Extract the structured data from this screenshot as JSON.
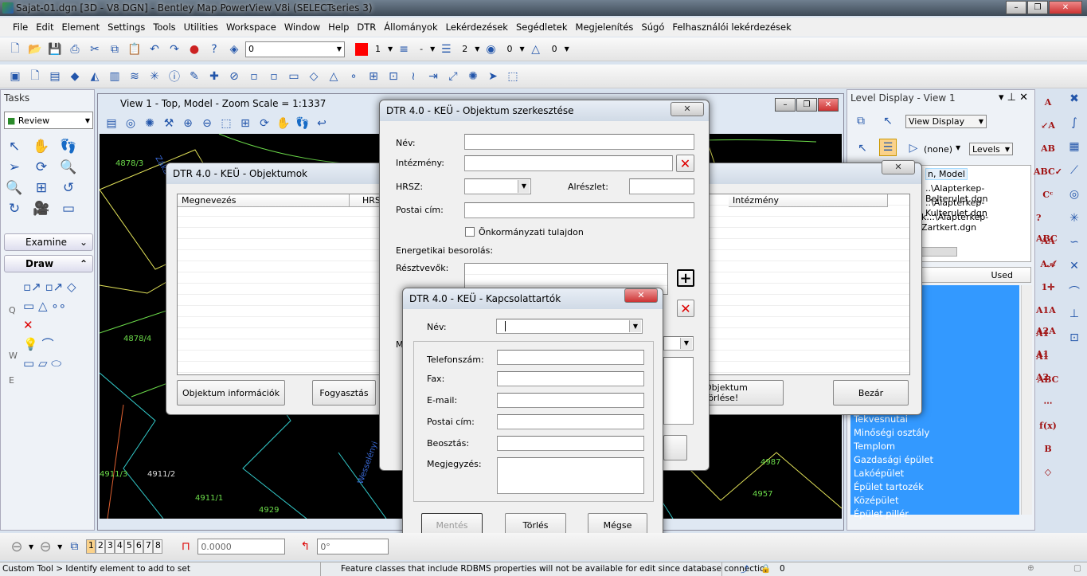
{
  "window": {
    "title": "Sajat-01.dgn [3D - V8 DGN] - Bentley Map PowerView V8i (SELECTseries 3)",
    "minimize": "–",
    "maximize": "❐",
    "close": "✕"
  },
  "menu": [
    "File",
    "Edit",
    "Element",
    "Settings",
    "Tools",
    "Utilities",
    "Workspace",
    "Window",
    "Help",
    "DTR",
    "Állományok",
    "Lekérdezések",
    "Segédletek",
    "Megjelenítés",
    "Súgó",
    "Felhasználói lekérdezések"
  ],
  "toolbar1": {
    "icons": [
      "new-file-icon",
      "open-folder-icon",
      "save-icon",
      "print-icon",
      "cut-icon",
      "copy-icon",
      "paste-icon",
      "undo-icon",
      "redo-icon",
      "render-icon",
      "help-icon",
      "level-icon"
    ],
    "level_value": "0",
    "color_value": "1",
    "style_value": "-",
    "weight_value": "2",
    "transparency_value": "0",
    "priority_value": "0",
    "color_accent": "#ff0000"
  },
  "toolbar2": {
    "icons": [
      "view-cube-icon",
      "model-icon",
      "references-icon",
      "raster-icon",
      "terrain-icon",
      "level-manager-icon",
      "layers-icon",
      "magic-icon",
      "info-icon",
      "edit-icon",
      "snap-icon",
      "no-entry-icon",
      "place-fence-icon",
      "modify-fence-icon",
      "fence-stretch-icon",
      "arc-icon",
      "triangle-icon",
      "circles-icon",
      "group-icon",
      "copy-element-icon",
      "wave-icon",
      "mirror-icon",
      "measure-icon",
      "bulb-icon",
      "select-arrow-icon",
      "select-box-icon"
    ]
  },
  "tasks": {
    "title": "Tasks",
    "review_label": "Review",
    "examine_label": "Examine",
    "draw_label": "Draw",
    "row_letters": [
      "Q",
      "W",
      "E"
    ]
  },
  "view": {
    "title": "View 1 - Top, Model - Zoom Scale = 1:1337"
  },
  "map_labels": [
    "4878/3",
    "Zákány",
    "4878/4",
    "4911/3",
    "4911/2",
    "4911/1",
    "4929",
    "4987",
    "4957",
    "Wesselényi"
  ],
  "objektumok": {
    "title": "DTR 4.0 - KEÜ - Objektumok",
    "columns": [
      "Megnevezés",
      "HRSZ",
      "Intézmény"
    ],
    "buttons": {
      "info": "Objektum információk",
      "fogyasztas": "Fogyasztás",
      "torles": "Objektum törlése!",
      "bezar": "Bezár"
    }
  },
  "szerkesztes": {
    "title": "DTR 4.0 - KEÜ - Objektum szerkesztése",
    "labels": {
      "nev": "Név:",
      "intezmeny": "Intézmény:",
      "hrsz": "HRSZ:",
      "alreszlet": "Alrészlet:",
      "postai": "Postai cím:",
      "onkormanyzati": "Önkormányzati tulajdon",
      "energetikai": "Energetikai besorolás:",
      "resztvevok": "Résztvevők:",
      "m": "M"
    },
    "browse": "...",
    "values": {
      "nev": "",
      "intezmeny": "",
      "hrsz": "",
      "alreszlet": "",
      "postai": ""
    },
    "onkormanyzati_checked": false
  },
  "kapcsolat": {
    "title": "DTR 4.0 - KEÜ - Kapcsolattartók",
    "labels": {
      "nev": "Név:",
      "telefon": "Telefonszám:",
      "fax": "Fax:",
      "email": "E-mail:",
      "postai": "Postai cím:",
      "beosztas": "Beosztás:",
      "megjegyzes": "Megjegyzés:"
    },
    "values": {
      "nev": "",
      "telefon": "",
      "fax": "",
      "email": "",
      "postai": "",
      "beosztas": "",
      "megjegyzes": ""
    },
    "buttons": {
      "mentes": "Mentés",
      "torles": "Törlés",
      "megse": "Mégse"
    }
  },
  "level_display": {
    "title": "Level Display - View 1",
    "view_display": "View Display",
    "filter": "(none)",
    "levels": "Levels",
    "tree": [
      "n, Model",
      "..\\Alapterkep-Belterulet.dgn",
      "..\\Alapterkep-Kulterulet.dgn",
      "k...\\Alapterkep-Zartkert.dgn"
    ],
    "used_header": "Used",
    "items": [
      "Tekvesnutai",
      "Minőségi osztály",
      "Templom",
      "Gazdasági épület",
      "Lakóépület",
      "Épület tartozék",
      "Középület",
      "Épület pillér"
    ],
    "selection_color": "#3399ff"
  },
  "right_tools": {
    "col1": [
      "A",
      "↙A",
      "AB",
      "ABC✓",
      "Cᶜ",
      "?ABC",
      "AA",
      "A𝒜",
      "1✛",
      "A1A A2A",
      "A1 A1",
      "A1 A2",
      "ABC",
      "⋯",
      "f(x)",
      "B",
      "◇"
    ],
    "col2": [
      "✖",
      "∫",
      "▦",
      "⟋",
      "◎",
      "✳",
      "∽",
      "✕",
      "⌒",
      "⊥",
      "⊡"
    ]
  },
  "bottom": {
    "views": [
      "1",
      "2",
      "3",
      "4",
      "5",
      "6",
      "7",
      "8"
    ],
    "distance": "0.0000",
    "angle": "0°"
  },
  "status": {
    "prompt": "Custom Tool > Identify element to add to set",
    "message": "Feature classes that include RDBMS properties will not be available for edit since database connectio",
    "level": "0"
  }
}
